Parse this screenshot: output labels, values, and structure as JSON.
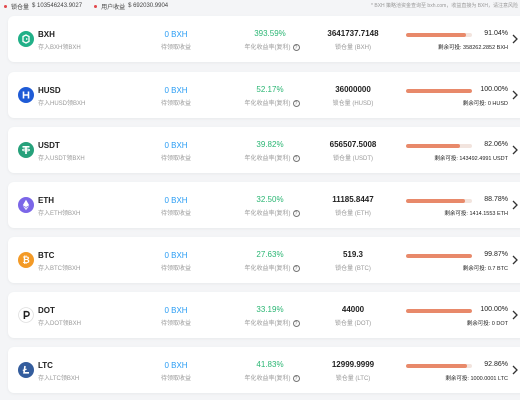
{
  "header": {
    "lock_label": "锁仓量",
    "lock_value": "$ 103546243.9027",
    "user_label": "用户收益",
    "user_value": "$ 692030.9904",
    "note": "* BXH 策略池资金查询至 bxh.com，收益直接为 BXH，请注意风险"
  },
  "colors": {
    "accent_red": "#e2474c",
    "pending_blue": "#2a9df4",
    "apr_green": "#2ab673",
    "progress": "#e8896a"
  },
  "labels": {
    "pending": "待领取收益",
    "apr": "年化收益率(复利)",
    "remaining_prefix": "剩余可投:"
  },
  "pools": [
    {
      "name": "BXH",
      "sub": "存入BXH领BXH",
      "pending": "0 BXH",
      "apr": "393.59%",
      "lock": "3641737.7148",
      "lock_unit": "锁仓量 (BXH)",
      "progress": 0.9104,
      "pct": "91.04%",
      "remaining": "358262.2852 BXH",
      "icon": "bxh-icon",
      "icon_color": "#21b088"
    },
    {
      "name": "HUSD",
      "sub": "存入HUSD领BXH",
      "pending": "0 BXH",
      "apr": "52.17%",
      "lock": "36000000",
      "lock_unit": "锁仓量 (HUSD)",
      "progress": 1.0,
      "pct": "100.00%",
      "remaining": "0 HUSD",
      "icon": "husd-icon",
      "icon_color": "#1f5bd6"
    },
    {
      "name": "USDT",
      "sub": "存入USDT领BXH",
      "pending": "0 BXH",
      "apr": "39.82%",
      "lock": "656507.5008",
      "lock_unit": "锁仓量 (USDT)",
      "progress": 0.8206,
      "pct": "82.06%",
      "remaining": "143492.4991 USDT",
      "icon": "usdt-icon",
      "icon_color": "#26a17b"
    },
    {
      "name": "ETH",
      "sub": "存入ETH领BXH",
      "pending": "0 BXH",
      "apr": "32.50%",
      "lock": "11185.8447",
      "lock_unit": "锁仓量 (ETH)",
      "progress": 0.8878,
      "pct": "88.78%",
      "remaining": "1414.1553 ETH",
      "icon": "eth-icon",
      "icon_color": "#7b66e8"
    },
    {
      "name": "BTC",
      "sub": "存入BTC领BXH",
      "pending": "0 BXH",
      "apr": "27.63%",
      "lock": "519.3",
      "lock_unit": "锁仓量 (BTC)",
      "progress": 0.9987,
      "pct": "99.87%",
      "remaining": "0.7 BTC",
      "icon": "btc-icon",
      "icon_color": "#f39a27"
    },
    {
      "name": "DOT",
      "sub": "存入DOT领BXH",
      "pending": "0 BXH",
      "apr": "33.19%",
      "lock": "44000",
      "lock_unit": "锁仓量 (DOT)",
      "progress": 1.0,
      "pct": "100.00%",
      "remaining": "0 DOT",
      "icon": "dot-icon",
      "icon_color": "#222222"
    },
    {
      "name": "LTC",
      "sub": "存入LTC领BXH",
      "pending": "0 BXH",
      "apr": "41.83%",
      "lock": "12999.9999",
      "lock_unit": "锁仓量 (LTC)",
      "progress": 0.9286,
      "pct": "92.86%",
      "remaining": "1000.0001 LTC",
      "icon": "ltc-icon",
      "icon_color": "#345d9d"
    }
  ]
}
